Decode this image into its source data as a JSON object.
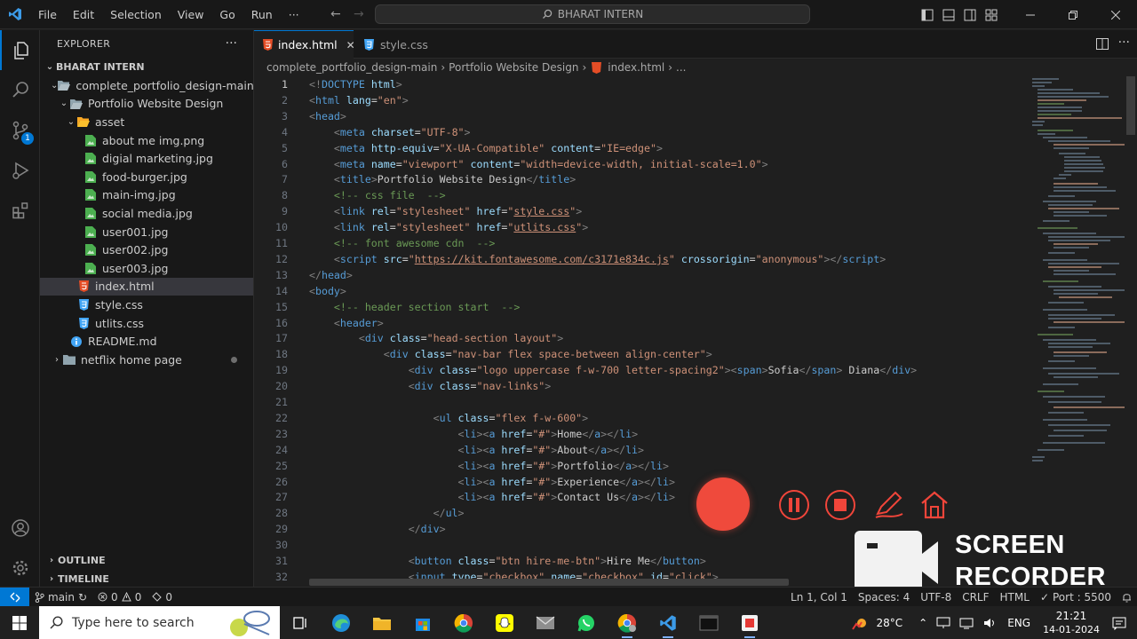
{
  "titlebar": {
    "menu": [
      "File",
      "Edit",
      "Selection",
      "View",
      "Go",
      "Run",
      "···"
    ],
    "search_text": "BHARAT INTERN"
  },
  "sidebar": {
    "header": "EXPLORER",
    "root": "BHARAT INTERN",
    "tree": [
      {
        "label": "complete_portfolio_design-main",
        "type": "folder",
        "open": true,
        "depth": 1
      },
      {
        "label": "Portfolio Website Design",
        "type": "folder",
        "open": true,
        "depth": 2
      },
      {
        "label": "asset",
        "type": "folder",
        "open": true,
        "depth": 3
      },
      {
        "label": "about me img.png",
        "type": "image",
        "depth": 4
      },
      {
        "label": "digial marketing.jpg",
        "type": "image",
        "depth": 4
      },
      {
        "label": "food-burger.jpg",
        "type": "image",
        "depth": 4
      },
      {
        "label": "main-img.jpg",
        "type": "image",
        "depth": 4
      },
      {
        "label": "social media.jpg",
        "type": "image",
        "depth": 4
      },
      {
        "label": "user001.jpg",
        "type": "image",
        "depth": 4
      },
      {
        "label": "user002.jpg",
        "type": "image",
        "depth": 4
      },
      {
        "label": "user003.jpg",
        "type": "image",
        "depth": 4
      },
      {
        "label": "index.html",
        "type": "html",
        "depth": 3,
        "selected": true
      },
      {
        "label": "style.css",
        "type": "css",
        "depth": 3
      },
      {
        "label": "utlits.css",
        "type": "css",
        "depth": 3
      },
      {
        "label": "README.md",
        "type": "info",
        "depth": 2
      },
      {
        "label": "netflix home page",
        "type": "folder",
        "open": false,
        "depth": 1
      }
    ],
    "outline": "OUTLINE",
    "timeline": "TIMELINE"
  },
  "activity": {
    "scm_badge": "1"
  },
  "tabs": [
    {
      "label": "index.html",
      "active": true
    },
    {
      "label": "style.css",
      "active": false
    }
  ],
  "breadcrumb": [
    "complete_portfolio_design-main",
    "Portfolio Website Design",
    "index.html",
    "..."
  ],
  "code": [
    {
      "n": "1",
      "t": [
        [
          "p",
          "<!"
        ],
        [
          "t",
          "DOCTYPE"
        ],
        [
          "x",
          " "
        ],
        [
          "a",
          "html"
        ],
        [
          "p",
          ">"
        ]
      ]
    },
    {
      "n": "2",
      "t": [
        [
          "p",
          "<"
        ],
        [
          "t",
          "html"
        ],
        [
          "x",
          " "
        ],
        [
          "a",
          "lang"
        ],
        [
          "x",
          "="
        ],
        [
          "s",
          "\"en\""
        ],
        [
          "p",
          ">"
        ]
      ]
    },
    {
      "n": "3",
      "t": [
        [
          "p",
          "<"
        ],
        [
          "t",
          "head"
        ],
        [
          "p",
          ">"
        ]
      ]
    },
    {
      "n": "4",
      "t": [
        [
          "x",
          "    "
        ],
        [
          "p",
          "<"
        ],
        [
          "t",
          "meta"
        ],
        [
          "x",
          " "
        ],
        [
          "a",
          "charset"
        ],
        [
          "x",
          "="
        ],
        [
          "s",
          "\"UTF-8\""
        ],
        [
          "p",
          ">"
        ]
      ]
    },
    {
      "n": "5",
      "t": [
        [
          "x",
          "    "
        ],
        [
          "p",
          "<"
        ],
        [
          "t",
          "meta"
        ],
        [
          "x",
          " "
        ],
        [
          "a",
          "http-equiv"
        ],
        [
          "x",
          "="
        ],
        [
          "s",
          "\"X-UA-Compatible\""
        ],
        [
          "x",
          " "
        ],
        [
          "a",
          "content"
        ],
        [
          "x",
          "="
        ],
        [
          "s",
          "\"IE=edge\""
        ],
        [
          "p",
          ">"
        ]
      ]
    },
    {
      "n": "6",
      "t": [
        [
          "x",
          "    "
        ],
        [
          "p",
          "<"
        ],
        [
          "t",
          "meta"
        ],
        [
          "x",
          " "
        ],
        [
          "a",
          "name"
        ],
        [
          "x",
          "="
        ],
        [
          "s",
          "\"viewport\""
        ],
        [
          "x",
          " "
        ],
        [
          "a",
          "content"
        ],
        [
          "x",
          "="
        ],
        [
          "s",
          "\"width=device-width, initial-scale=1.0\""
        ],
        [
          "p",
          ">"
        ]
      ]
    },
    {
      "n": "7",
      "t": [
        [
          "x",
          "    "
        ],
        [
          "p",
          "<"
        ],
        [
          "t",
          "title"
        ],
        [
          "p",
          ">"
        ],
        [
          "x",
          "Portfolio Website Design"
        ],
        [
          "p",
          "</"
        ],
        [
          "t",
          "title"
        ],
        [
          "p",
          ">"
        ]
      ]
    },
    {
      "n": "8",
      "t": [
        [
          "x",
          "    "
        ],
        [
          "c",
          "<!-- css file  -->"
        ]
      ]
    },
    {
      "n": "9",
      "t": [
        [
          "x",
          "    "
        ],
        [
          "p",
          "<"
        ],
        [
          "t",
          "link"
        ],
        [
          "x",
          " "
        ],
        [
          "a",
          "rel"
        ],
        [
          "x",
          "="
        ],
        [
          "s",
          "\"stylesheet\""
        ],
        [
          "x",
          " "
        ],
        [
          "a",
          "href"
        ],
        [
          "x",
          "="
        ],
        [
          "s",
          "\""
        ],
        [
          "u",
          "style.css"
        ],
        [
          "s",
          "\""
        ],
        [
          "p",
          ">"
        ]
      ]
    },
    {
      "n": "10",
      "t": [
        [
          "x",
          "    "
        ],
        [
          "p",
          "<"
        ],
        [
          "t",
          "link"
        ],
        [
          "x",
          " "
        ],
        [
          "a",
          "rel"
        ],
        [
          "x",
          "="
        ],
        [
          "s",
          "\"stylesheet\""
        ],
        [
          "x",
          " "
        ],
        [
          "a",
          "href"
        ],
        [
          "x",
          "="
        ],
        [
          "s",
          "\""
        ],
        [
          "u",
          "utlits.css"
        ],
        [
          "s",
          "\""
        ],
        [
          "p",
          ">"
        ]
      ]
    },
    {
      "n": "11",
      "t": [
        [
          "x",
          "    "
        ],
        [
          "c",
          "<!-- font awesome cdn  -->"
        ]
      ]
    },
    {
      "n": "12",
      "t": [
        [
          "x",
          "    "
        ],
        [
          "p",
          "<"
        ],
        [
          "t",
          "script"
        ],
        [
          "x",
          " "
        ],
        [
          "a",
          "src"
        ],
        [
          "x",
          "="
        ],
        [
          "s",
          "\""
        ],
        [
          "u",
          "https://kit.fontawesome.com/c3171e834c.js"
        ],
        [
          "s",
          "\""
        ],
        [
          "x",
          " "
        ],
        [
          "a",
          "crossorigin"
        ],
        [
          "x",
          "="
        ],
        [
          "s",
          "\"anonymous\""
        ],
        [
          "p",
          "></"
        ],
        [
          "t",
          "script"
        ],
        [
          "p",
          ">"
        ]
      ]
    },
    {
      "n": "13",
      "t": [
        [
          "p",
          "</"
        ],
        [
          "t",
          "head"
        ],
        [
          "p",
          ">"
        ]
      ]
    },
    {
      "n": "14",
      "t": [
        [
          "p",
          "<"
        ],
        [
          "t",
          "body"
        ],
        [
          "p",
          ">"
        ]
      ]
    },
    {
      "n": "15",
      "t": [
        [
          "x",
          "    "
        ],
        [
          "c",
          "<!-- header section start  -->"
        ]
      ]
    },
    {
      "n": "16",
      "t": [
        [
          "x",
          "    "
        ],
        [
          "p",
          "<"
        ],
        [
          "t",
          "header"
        ],
        [
          "p",
          ">"
        ]
      ]
    },
    {
      "n": "17",
      "t": [
        [
          "x",
          "        "
        ],
        [
          "p",
          "<"
        ],
        [
          "t",
          "div"
        ],
        [
          "x",
          " "
        ],
        [
          "a",
          "class"
        ],
        [
          "x",
          "="
        ],
        [
          "s",
          "\"head-section layout\""
        ],
        [
          "p",
          ">"
        ]
      ]
    },
    {
      "n": "18",
      "t": [
        [
          "x",
          "            "
        ],
        [
          "p",
          "<"
        ],
        [
          "t",
          "div"
        ],
        [
          "x",
          " "
        ],
        [
          "a",
          "class"
        ],
        [
          "x",
          "="
        ],
        [
          "s",
          "\"nav-bar flex space-between align-center\""
        ],
        [
          "p",
          ">"
        ]
      ]
    },
    {
      "n": "19",
      "t": [
        [
          "x",
          "                "
        ],
        [
          "p",
          "<"
        ],
        [
          "t",
          "div"
        ],
        [
          "x",
          " "
        ],
        [
          "a",
          "class"
        ],
        [
          "x",
          "="
        ],
        [
          "s",
          "\"logo uppercase f-w-700 letter-spacing2\""
        ],
        [
          "p",
          "><"
        ],
        [
          "t",
          "span"
        ],
        [
          "p",
          ">"
        ],
        [
          "x",
          "Sofia"
        ],
        [
          "p",
          "</"
        ],
        [
          "t",
          "span"
        ],
        [
          "p",
          ">"
        ],
        [
          "x",
          " Diana"
        ],
        [
          "p",
          "</"
        ],
        [
          "t",
          "div"
        ],
        [
          "p",
          ">"
        ]
      ]
    },
    {
      "n": "20",
      "t": [
        [
          "x",
          "                "
        ],
        [
          "p",
          "<"
        ],
        [
          "t",
          "div"
        ],
        [
          "x",
          " "
        ],
        [
          "a",
          "class"
        ],
        [
          "x",
          "="
        ],
        [
          "s",
          "\"nav-links\""
        ],
        [
          "p",
          ">"
        ]
      ]
    },
    {
      "n": "21",
      "t": []
    },
    {
      "n": "22",
      "t": [
        [
          "x",
          "                    "
        ],
        [
          "p",
          "<"
        ],
        [
          "t",
          "ul"
        ],
        [
          "x",
          " "
        ],
        [
          "a",
          "class"
        ],
        [
          "x",
          "="
        ],
        [
          "s",
          "\"flex f-w-600\""
        ],
        [
          "p",
          ">"
        ]
      ]
    },
    {
      "n": "23",
      "t": [
        [
          "x",
          "                        "
        ],
        [
          "p",
          "<"
        ],
        [
          "t",
          "li"
        ],
        [
          "p",
          "><"
        ],
        [
          "t",
          "a"
        ],
        [
          "x",
          " "
        ],
        [
          "a",
          "href"
        ],
        [
          "x",
          "="
        ],
        [
          "s",
          "\"#\""
        ],
        [
          "p",
          ">"
        ],
        [
          "x",
          "Home"
        ],
        [
          "p",
          "</"
        ],
        [
          "t",
          "a"
        ],
        [
          "p",
          "></"
        ],
        [
          "t",
          "li"
        ],
        [
          "p",
          ">"
        ]
      ]
    },
    {
      "n": "24",
      "t": [
        [
          "x",
          "                        "
        ],
        [
          "p",
          "<"
        ],
        [
          "t",
          "li"
        ],
        [
          "p",
          "><"
        ],
        [
          "t",
          "a"
        ],
        [
          "x",
          " "
        ],
        [
          "a",
          "href"
        ],
        [
          "x",
          "="
        ],
        [
          "s",
          "\"#\""
        ],
        [
          "p",
          ">"
        ],
        [
          "x",
          "About"
        ],
        [
          "p",
          "</"
        ],
        [
          "t",
          "a"
        ],
        [
          "p",
          "></"
        ],
        [
          "t",
          "li"
        ],
        [
          "p",
          ">"
        ]
      ]
    },
    {
      "n": "25",
      "t": [
        [
          "x",
          "                        "
        ],
        [
          "p",
          "<"
        ],
        [
          "t",
          "li"
        ],
        [
          "p",
          "><"
        ],
        [
          "t",
          "a"
        ],
        [
          "x",
          " "
        ],
        [
          "a",
          "href"
        ],
        [
          "x",
          "="
        ],
        [
          "s",
          "\"#\""
        ],
        [
          "p",
          ">"
        ],
        [
          "x",
          "Portfolio"
        ],
        [
          "p",
          "</"
        ],
        [
          "t",
          "a"
        ],
        [
          "p",
          "></"
        ],
        [
          "t",
          "li"
        ],
        [
          "p",
          ">"
        ]
      ]
    },
    {
      "n": "26",
      "t": [
        [
          "x",
          "                        "
        ],
        [
          "p",
          "<"
        ],
        [
          "t",
          "li"
        ],
        [
          "p",
          "><"
        ],
        [
          "t",
          "a"
        ],
        [
          "x",
          " "
        ],
        [
          "a",
          "href"
        ],
        [
          "x",
          "="
        ],
        [
          "s",
          "\"#\""
        ],
        [
          "p",
          ">"
        ],
        [
          "x",
          "Experience"
        ],
        [
          "p",
          "</"
        ],
        [
          "t",
          "a"
        ],
        [
          "p",
          "></"
        ],
        [
          "t",
          "li"
        ],
        [
          "p",
          ">"
        ]
      ]
    },
    {
      "n": "27",
      "t": [
        [
          "x",
          "                        "
        ],
        [
          "p",
          "<"
        ],
        [
          "t",
          "li"
        ],
        [
          "p",
          "><"
        ],
        [
          "t",
          "a"
        ],
        [
          "x",
          " "
        ],
        [
          "a",
          "href"
        ],
        [
          "x",
          "="
        ],
        [
          "s",
          "\"#\""
        ],
        [
          "p",
          ">"
        ],
        [
          "x",
          "Contact Us"
        ],
        [
          "p",
          "</"
        ],
        [
          "t",
          "a"
        ],
        [
          "p",
          "></"
        ],
        [
          "t",
          "li"
        ],
        [
          "p",
          ">"
        ]
      ]
    },
    {
      "n": "28",
      "t": [
        [
          "x",
          "                    "
        ],
        [
          "p",
          "</"
        ],
        [
          "t",
          "ul"
        ],
        [
          "p",
          ">"
        ]
      ]
    },
    {
      "n": "29",
      "t": [
        [
          "x",
          "                "
        ],
        [
          "p",
          "</"
        ],
        [
          "t",
          "div"
        ],
        [
          "p",
          ">"
        ]
      ]
    },
    {
      "n": "30",
      "t": []
    },
    {
      "n": "31",
      "t": [
        [
          "x",
          "                "
        ],
        [
          "p",
          "<"
        ],
        [
          "t",
          "button"
        ],
        [
          "x",
          " "
        ],
        [
          "a",
          "class"
        ],
        [
          "x",
          "="
        ],
        [
          "s",
          "\"btn hire-me-btn\""
        ],
        [
          "p",
          ">"
        ],
        [
          "x",
          "Hire Me"
        ],
        [
          "p",
          "</"
        ],
        [
          "t",
          "button"
        ],
        [
          "p",
          ">"
        ]
      ]
    },
    {
      "n": "32",
      "t": [
        [
          "x",
          "                "
        ],
        [
          "p",
          "<"
        ],
        [
          "t",
          "input"
        ],
        [
          "x",
          " "
        ],
        [
          "a",
          "type"
        ],
        [
          "x",
          "="
        ],
        [
          "s",
          "\"checkbox\""
        ],
        [
          "x",
          " "
        ],
        [
          "a",
          "name"
        ],
        [
          "x",
          "="
        ],
        [
          "s",
          "\"checkbox\""
        ],
        [
          "x",
          " "
        ],
        [
          "a",
          "id"
        ],
        [
          "x",
          "="
        ],
        [
          "s",
          "\"click\""
        ],
        [
          "p",
          ">"
        ]
      ]
    }
  ],
  "recorder": {
    "line1": "SCREEN",
    "line2": "RECORDER"
  },
  "status": {
    "branch": "main",
    "errors": "0",
    "warnings": "0",
    "ports": "0",
    "position": "Ln 1, Col 1",
    "spaces": "Spaces: 4",
    "encoding": "UTF-8",
    "eol": "CRLF",
    "language": "HTML",
    "port": "Port : 5500"
  },
  "taskbar": {
    "search_placeholder": "Type here to search",
    "temperature": "28°C",
    "language": "ENG",
    "time": "21:21",
    "date": "14-01-2024"
  }
}
